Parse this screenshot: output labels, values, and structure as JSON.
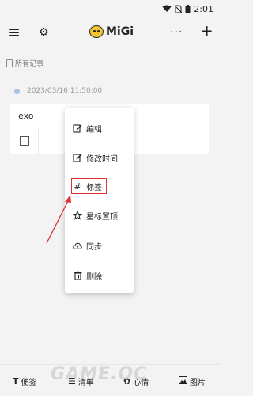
{
  "status_bar": {
    "time": "2:01"
  },
  "app_bar": {
    "logo_text": "MiGi",
    "more_glyph": "···",
    "add_glyph": "+"
  },
  "breadcrumb": {
    "label": "所有记事"
  },
  "note": {
    "timestamp": "2023/03/16 11:50:00",
    "title": "exo"
  },
  "context_menu": {
    "items": [
      {
        "label": "编辑",
        "icon": "edit-icon"
      },
      {
        "label": "修改时间",
        "icon": "edit-time-icon"
      },
      {
        "label": "标签",
        "icon": "hash-icon"
      },
      {
        "label": "星标置顶",
        "icon": "star-icon"
      },
      {
        "label": "同步",
        "icon": "cloud-upload-icon"
      },
      {
        "label": "删除",
        "icon": "trash-icon"
      }
    ],
    "highlight_color": "#e03232"
  },
  "bottom_bar": {
    "items": [
      {
        "label": "便签",
        "icon": "text-icon"
      },
      {
        "label": "清单",
        "icon": "checklist-icon"
      },
      {
        "label": "心情",
        "icon": "mood-icon"
      },
      {
        "label": "图片",
        "icon": "image-icon"
      }
    ]
  },
  "watermark": {
    "text": "GAME.OC"
  }
}
